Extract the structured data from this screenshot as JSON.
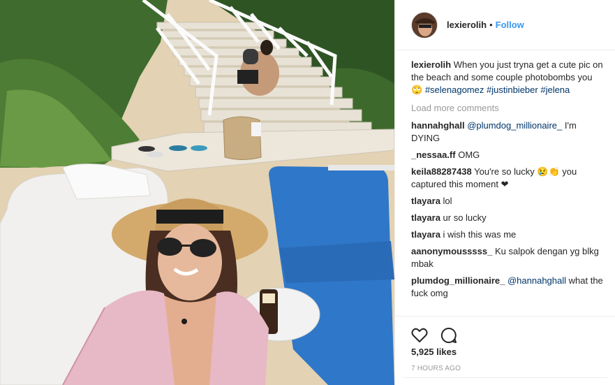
{
  "post": {
    "username": "lexierolih",
    "separator": "•",
    "follow_label": "Follow"
  },
  "caption": {
    "username": "lexierolih",
    "text": " When you just tryna get a cute pic on the beach and some couple photobombs you 🙄 ",
    "tags": [
      "#selenagomez",
      "#justinbieber",
      "#jelena"
    ]
  },
  "load_more_label": "Load more comments",
  "comments": [
    {
      "user": "hannahghall",
      "mention": "@plumdog_millionaire_",
      "text": " I'm DYING"
    },
    {
      "user": "_nessaa.ff",
      "mention": "",
      "text": " OMG"
    },
    {
      "user": "keila88287438",
      "mention": "",
      "text": " You're so lucky 😢👏 you captured this moment ❤"
    },
    {
      "user": "tlayara",
      "mention": "",
      "text": " lol"
    },
    {
      "user": "tlayara",
      "mention": "",
      "text": " ur so lucky"
    },
    {
      "user": "tlayara",
      "mention": "",
      "text": " i wish this was me"
    },
    {
      "user": "aanonymousssss_",
      "mention": "",
      "text": " Ku salpok dengan yg blkg mbak"
    },
    {
      "user": "plumdog_millionaire_",
      "mention": "@hannahghall",
      "text": " what the fuck omg"
    }
  ],
  "likes": "5,925 likes",
  "time": "7 HOURS AGO",
  "icons": {
    "like": "heart-icon",
    "comment": "comment-bubble-icon"
  }
}
